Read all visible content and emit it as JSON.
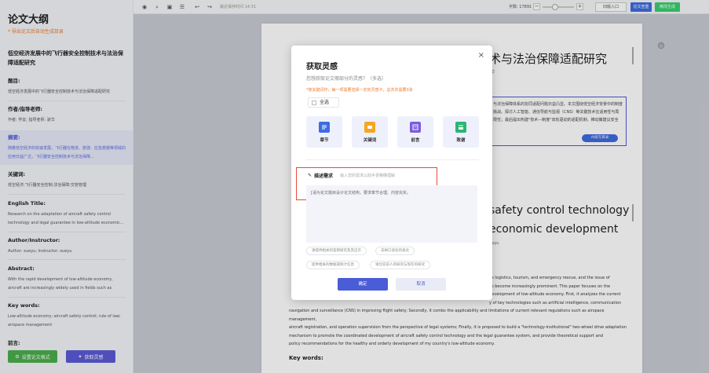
{
  "sidebar": {
    "title": "论文大纲",
    "tip": "* 导出论文后自动生成目录",
    "paper_title": "低空经济发展中的飞行器安全控制技术与法治保障适配研究",
    "sections": [
      {
        "heading": "题目:",
        "text": "低空经济发展中的飞行器安全控制技术与法治保障适配研究"
      },
      {
        "heading": "作者/指导老师:",
        "text": "作者: 学友; 指导老师: 骄华"
      },
      {
        "heading": "摘要:",
        "text": "随着低空经济的快速发展，飞行器在物流、旅游、应急救援等领域的应用日益广泛，飞行器安全控制技术与法治保障..."
      },
      {
        "heading": "关键词:",
        "text": "低空经济;飞行器安全控制;法治保障;交管管理"
      },
      {
        "heading": "English Title:",
        "text": "Research on the adaptation of aircraft safety control technology and legal guarantee in low-altitude economic..."
      },
      {
        "heading": "Author/Instructor:",
        "text": "Author: xueyu; Instructor: xueyu"
      },
      {
        "heading": "Abstract:",
        "text": "With the rapid development of low-altitude economy, aircraft are increasingly widely used in fields such as logistics,..."
      },
      {
        "heading": "Key words:",
        "text": "Low-altitude economy; aircraft safety control; rule of law; airspace management"
      },
      {
        "heading": "前言:",
        "text": ""
      }
    ],
    "btn_format": "设置论文格式",
    "btn_inspiration": "获取灵感"
  },
  "toolbar": {
    "save_time": "最近保存时间 14:31",
    "word_count": "字数: 17891",
    "old_entry": "旧版入口",
    "check": "论文查重",
    "generate": "精改生成"
  },
  "doc": {
    "title_cn": "术与法治保障适配研究",
    "author_cn": "华",
    "abstract_cn": "与法治保障体系的协同适配问题日益凸显。本文围绕低空经济背景中的制度挑战。探讨人工智能、通信导航与监视（CNS）等关键技术在适用性与局限性；最后提出构建\"技术—制度\"双轮驱动的适配机制，推动策建议安全",
    "ai_btn": "AI续写目录",
    "title_en_1": "safety control technology",
    "title_en_2": "economic development",
    "author_en": "ueyu",
    "abstract_en_lines": [
      "as logistics, tourism, and emergency rescue, and the issue of",
      "as become increasingly prominent. This paper focuses on the",
      "development of low-altitude economy. First, it analyzes the current",
      "y of key technologies such as artificial intelligence, communication",
      "navigation and surveillance (CNS) in improving flight safety; Secondly, it combs the applicability and limitations of current relevant regulations such as airspace management,",
      "aircraft registration, and operation supervision from the perspective of legal systems; Finally, it is proposed to build a \"technology-institutional\" two-wheel drive adaptation",
      "mechanism to promote the coordinated development of aircraft safety control technology and the legal guarantee system, and provide theoretical support and",
      "policy recommendations for the healthy and orderly development of my country's low-altitude economy."
    ],
    "kw_label_en": "Key words:"
  },
  "modal": {
    "title": "获取灵感",
    "subtitle": "您想获取论文哪部分的灵感？（多选）",
    "warning": "*按关键词作，每一项需要选择一定的灵感卡，总共共需要0张",
    "select_all": "全选",
    "cards": [
      {
        "label": "章节",
        "color": "#3e6be0"
      },
      {
        "label": "关键词",
        "color": "#f5a623"
      },
      {
        "label": "前言",
        "color": "#7b5ce0"
      },
      {
        "label": "致谢",
        "color": "#2bb673"
      }
    ],
    "desc_label": "描述需求",
    "desc_hint": "输入您的需求以助手更精确理解",
    "textarea_placeholder": "[请为论文题目设计论文结构，要求章节合理、内容充实。",
    "chips": [
      "请提供相关的案例研究及其启示",
      "去掉口语化的表达",
      "提供相关的数据或统计信息",
      "请比较前人的研究与现在的研究"
    ],
    "ok": "确定",
    "cancel": "取消"
  }
}
